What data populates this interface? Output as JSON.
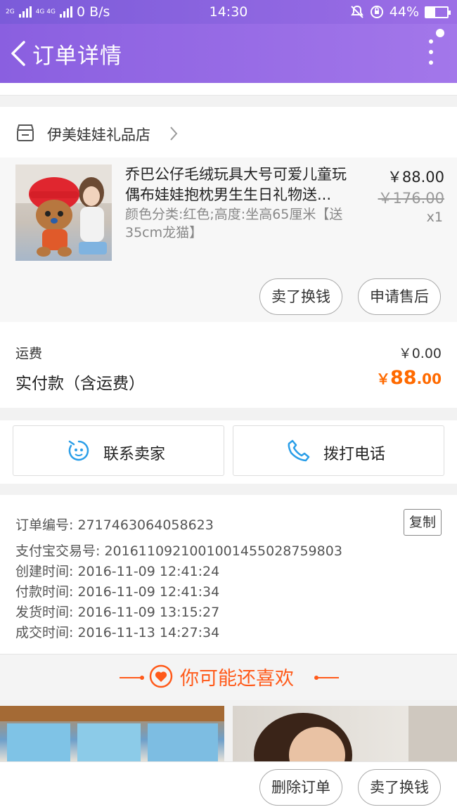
{
  "status_bar": {
    "net_left": "2G",
    "net_right": "4G 4G",
    "speed": "0 B/s",
    "time": "14:30",
    "battery": "44%",
    "battery_fraction": 0.44
  },
  "header": {
    "title": "订单详情"
  },
  "shop": {
    "name": "伊美娃娃礼品店"
  },
  "product": {
    "title": "乔巴公仔毛绒玩具大号可爱儿童玩偶布娃娃抱枕男生生日礼物送...",
    "sku": "颜色分类:红色;高度:坐高65厘米【送35cm龙猫】",
    "price": "￥88.00",
    "original_price": "￥176.00",
    "quantity": "x1",
    "sell_button": "卖了换钱",
    "aftersale_button": "申请售后"
  },
  "fees": {
    "shipping_label": "运费",
    "shipping_value": "￥0.00",
    "paid_label": "实付款（含运费）",
    "paid_symbol": "￥",
    "paid_int": "88",
    "paid_dec": ".00"
  },
  "contact": {
    "seller_label": "联系卖家",
    "phone_label": "拨打电话"
  },
  "order_info": {
    "order_no": "订单编号: 2717463064058623",
    "alipay_no": "支付宝交易号: 2016110921001001455028759803",
    "created": "创建时间: 2016-11-09 12:41:24",
    "paid": "付款时间: 2016-11-09 12:41:34",
    "shipped": "发货时间: 2016-11-09 13:15:27",
    "completed": "成交时间: 2016-11-13 14:27:34",
    "copy_button": "复制"
  },
  "recommend": {
    "title": "你可能还喜欢"
  },
  "bottom_bar": {
    "delete_button": "删除订单",
    "sell_button": "卖了换钱"
  },
  "colors": {
    "header_start": "#8a5fe0",
    "header_end": "#a377ea",
    "accent": "#ff6a00",
    "contact_icon": "#2a9ee8"
  }
}
